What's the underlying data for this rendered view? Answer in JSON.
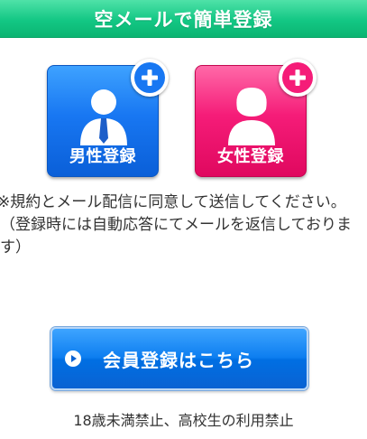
{
  "header": {
    "title": "空メールで簡単登録"
  },
  "registration": {
    "male_label": "男性登録",
    "female_label": "女性登録"
  },
  "notice": {
    "line1": "※規約とメール配信に同意して送信してください。",
    "line2": "（登録時には自動応答にてメールを返信しております）"
  },
  "member_button": {
    "label": "会員登録はこちら",
    "icon": "play-circle-icon"
  },
  "footnote": "18歳未満禁止、高校生の利用禁止",
  "colors": {
    "header": "#13c784",
    "male": "#1877f2",
    "female": "#f51c78",
    "member_button": "#0d7ef0",
    "text": "#333333"
  }
}
